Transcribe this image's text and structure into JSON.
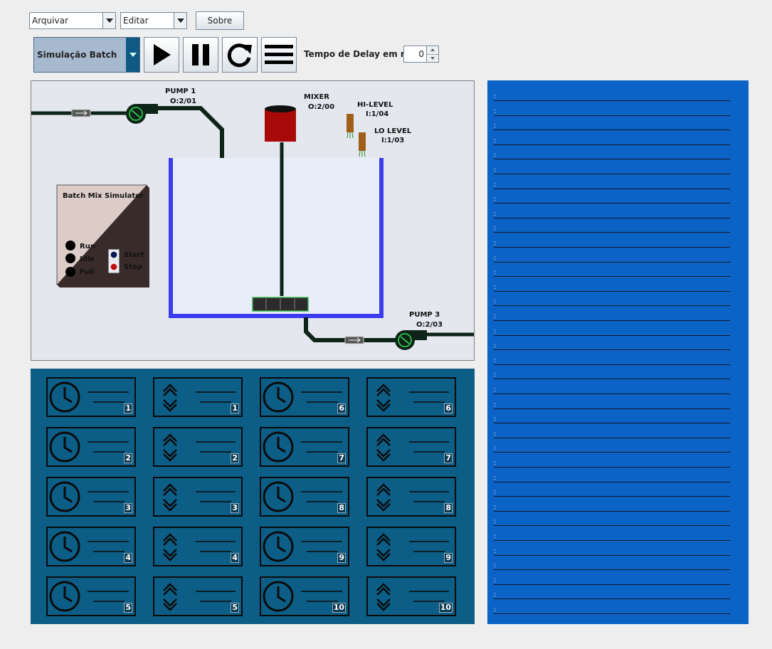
{
  "menu": {
    "file": "Arquivar",
    "edit": "Editar",
    "about": "Sobre"
  },
  "toolbar": {
    "mode_select": "Simulação Batch",
    "play_icon": "play-icon",
    "pause_icon": "pause-icon",
    "restart_icon": "restart-icon",
    "menu_icon": "hamburger-menu-icon",
    "delay_label": "Tempo de Delay em ms:",
    "delay_value": "0"
  },
  "simulator": {
    "pump1_name": "PUMP 1",
    "pump1_addr": "O:2/01",
    "mixer_name": "MIXER",
    "mixer_addr": "O:2/00",
    "hilevel_name": "HI-LEVEL",
    "hilevel_addr": "I:1/04",
    "lolevel_name": "LO LEVEL",
    "lolevel_addr": "I:1/03",
    "pump3_name": "PUMP 3",
    "pump3_addr": "O:2/03",
    "panel": {
      "title": "Batch Mix Simulator",
      "run": "Run",
      "idle": "Idle",
      "full": "Full",
      "start": "Start",
      "stop": "Stop"
    },
    "colors": {
      "tank_wall": "#3b3bf0",
      "mixer": "#a80a0a",
      "pipe": "#0f2418",
      "sensor": "#a0601a"
    }
  },
  "blocks": {
    "rows": [
      [
        {
          "type": "timer",
          "n": "1"
        },
        {
          "type": "counter",
          "n": "1"
        },
        {
          "type": "timer",
          "n": "6"
        },
        {
          "type": "counter",
          "n": "6"
        }
      ],
      [
        {
          "type": "timer",
          "n": "2"
        },
        {
          "type": "counter",
          "n": "2"
        },
        {
          "type": "timer",
          "n": "7"
        },
        {
          "type": "counter",
          "n": "7"
        }
      ],
      [
        {
          "type": "timer",
          "n": "3"
        },
        {
          "type": "counter",
          "n": "3"
        },
        {
          "type": "timer",
          "n": "8"
        },
        {
          "type": "counter",
          "n": "8"
        }
      ],
      [
        {
          "type": "timer",
          "n": "4"
        },
        {
          "type": "counter",
          "n": "4"
        },
        {
          "type": "timer",
          "n": "9"
        },
        {
          "type": "counter",
          "n": "9"
        }
      ],
      [
        {
          "type": "timer",
          "n": "5"
        },
        {
          "type": "counter",
          "n": "5"
        },
        {
          "type": "timer",
          "n": "10"
        },
        {
          "type": "counter",
          "n": "10"
        }
      ]
    ]
  },
  "log": {
    "line_count": 36,
    "prefix": ":"
  }
}
